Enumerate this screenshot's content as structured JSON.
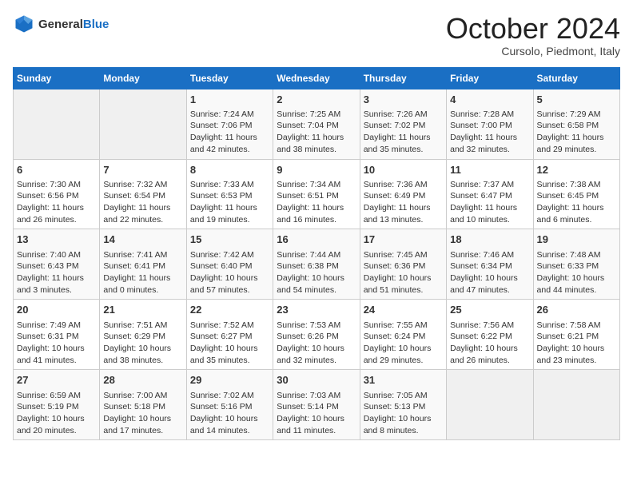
{
  "header": {
    "logo_general": "General",
    "logo_blue": "Blue",
    "month_title": "October 2024",
    "location": "Cursolo, Piedmont, Italy"
  },
  "days_of_week": [
    "Sunday",
    "Monday",
    "Tuesday",
    "Wednesday",
    "Thursday",
    "Friday",
    "Saturday"
  ],
  "weeks": [
    [
      {
        "day": "",
        "sunrise": "",
        "sunset": "",
        "daylight": "",
        "empty": true
      },
      {
        "day": "",
        "sunrise": "",
        "sunset": "",
        "daylight": "",
        "empty": true
      },
      {
        "day": "1",
        "sunrise": "Sunrise: 7:24 AM",
        "sunset": "Sunset: 7:06 PM",
        "daylight": "Daylight: 11 hours and 42 minutes."
      },
      {
        "day": "2",
        "sunrise": "Sunrise: 7:25 AM",
        "sunset": "Sunset: 7:04 PM",
        "daylight": "Daylight: 11 hours and 38 minutes."
      },
      {
        "day": "3",
        "sunrise": "Sunrise: 7:26 AM",
        "sunset": "Sunset: 7:02 PM",
        "daylight": "Daylight: 11 hours and 35 minutes."
      },
      {
        "day": "4",
        "sunrise": "Sunrise: 7:28 AM",
        "sunset": "Sunset: 7:00 PM",
        "daylight": "Daylight: 11 hours and 32 minutes."
      },
      {
        "day": "5",
        "sunrise": "Sunrise: 7:29 AM",
        "sunset": "Sunset: 6:58 PM",
        "daylight": "Daylight: 11 hours and 29 minutes."
      }
    ],
    [
      {
        "day": "6",
        "sunrise": "Sunrise: 7:30 AM",
        "sunset": "Sunset: 6:56 PM",
        "daylight": "Daylight: 11 hours and 26 minutes."
      },
      {
        "day": "7",
        "sunrise": "Sunrise: 7:32 AM",
        "sunset": "Sunset: 6:54 PM",
        "daylight": "Daylight: 11 hours and 22 minutes."
      },
      {
        "day": "8",
        "sunrise": "Sunrise: 7:33 AM",
        "sunset": "Sunset: 6:53 PM",
        "daylight": "Daylight: 11 hours and 19 minutes."
      },
      {
        "day": "9",
        "sunrise": "Sunrise: 7:34 AM",
        "sunset": "Sunset: 6:51 PM",
        "daylight": "Daylight: 11 hours and 16 minutes."
      },
      {
        "day": "10",
        "sunrise": "Sunrise: 7:36 AM",
        "sunset": "Sunset: 6:49 PM",
        "daylight": "Daylight: 11 hours and 13 minutes."
      },
      {
        "day": "11",
        "sunrise": "Sunrise: 7:37 AM",
        "sunset": "Sunset: 6:47 PM",
        "daylight": "Daylight: 11 hours and 10 minutes."
      },
      {
        "day": "12",
        "sunrise": "Sunrise: 7:38 AM",
        "sunset": "Sunset: 6:45 PM",
        "daylight": "Daylight: 11 hours and 6 minutes."
      }
    ],
    [
      {
        "day": "13",
        "sunrise": "Sunrise: 7:40 AM",
        "sunset": "Sunset: 6:43 PM",
        "daylight": "Daylight: 11 hours and 3 minutes."
      },
      {
        "day": "14",
        "sunrise": "Sunrise: 7:41 AM",
        "sunset": "Sunset: 6:41 PM",
        "daylight": "Daylight: 11 hours and 0 minutes."
      },
      {
        "day": "15",
        "sunrise": "Sunrise: 7:42 AM",
        "sunset": "Sunset: 6:40 PM",
        "daylight": "Daylight: 10 hours and 57 minutes."
      },
      {
        "day": "16",
        "sunrise": "Sunrise: 7:44 AM",
        "sunset": "Sunset: 6:38 PM",
        "daylight": "Daylight: 10 hours and 54 minutes."
      },
      {
        "day": "17",
        "sunrise": "Sunrise: 7:45 AM",
        "sunset": "Sunset: 6:36 PM",
        "daylight": "Daylight: 10 hours and 51 minutes."
      },
      {
        "day": "18",
        "sunrise": "Sunrise: 7:46 AM",
        "sunset": "Sunset: 6:34 PM",
        "daylight": "Daylight: 10 hours and 47 minutes."
      },
      {
        "day": "19",
        "sunrise": "Sunrise: 7:48 AM",
        "sunset": "Sunset: 6:33 PM",
        "daylight": "Daylight: 10 hours and 44 minutes."
      }
    ],
    [
      {
        "day": "20",
        "sunrise": "Sunrise: 7:49 AM",
        "sunset": "Sunset: 6:31 PM",
        "daylight": "Daylight: 10 hours and 41 minutes."
      },
      {
        "day": "21",
        "sunrise": "Sunrise: 7:51 AM",
        "sunset": "Sunset: 6:29 PM",
        "daylight": "Daylight: 10 hours and 38 minutes."
      },
      {
        "day": "22",
        "sunrise": "Sunrise: 7:52 AM",
        "sunset": "Sunset: 6:27 PM",
        "daylight": "Daylight: 10 hours and 35 minutes."
      },
      {
        "day": "23",
        "sunrise": "Sunrise: 7:53 AM",
        "sunset": "Sunset: 6:26 PM",
        "daylight": "Daylight: 10 hours and 32 minutes."
      },
      {
        "day": "24",
        "sunrise": "Sunrise: 7:55 AM",
        "sunset": "Sunset: 6:24 PM",
        "daylight": "Daylight: 10 hours and 29 minutes."
      },
      {
        "day": "25",
        "sunrise": "Sunrise: 7:56 AM",
        "sunset": "Sunset: 6:22 PM",
        "daylight": "Daylight: 10 hours and 26 minutes."
      },
      {
        "day": "26",
        "sunrise": "Sunrise: 7:58 AM",
        "sunset": "Sunset: 6:21 PM",
        "daylight": "Daylight: 10 hours and 23 minutes."
      }
    ],
    [
      {
        "day": "27",
        "sunrise": "Sunrise: 6:59 AM",
        "sunset": "Sunset: 5:19 PM",
        "daylight": "Daylight: 10 hours and 20 minutes."
      },
      {
        "day": "28",
        "sunrise": "Sunrise: 7:00 AM",
        "sunset": "Sunset: 5:18 PM",
        "daylight": "Daylight: 10 hours and 17 minutes."
      },
      {
        "day": "29",
        "sunrise": "Sunrise: 7:02 AM",
        "sunset": "Sunset: 5:16 PM",
        "daylight": "Daylight: 10 hours and 14 minutes."
      },
      {
        "day": "30",
        "sunrise": "Sunrise: 7:03 AM",
        "sunset": "Sunset: 5:14 PM",
        "daylight": "Daylight: 10 hours and 11 minutes."
      },
      {
        "day": "31",
        "sunrise": "Sunrise: 7:05 AM",
        "sunset": "Sunset: 5:13 PM",
        "daylight": "Daylight: 10 hours and 8 minutes."
      },
      {
        "day": "",
        "sunrise": "",
        "sunset": "",
        "daylight": "",
        "empty": true
      },
      {
        "day": "",
        "sunrise": "",
        "sunset": "",
        "daylight": "",
        "empty": true
      }
    ]
  ]
}
